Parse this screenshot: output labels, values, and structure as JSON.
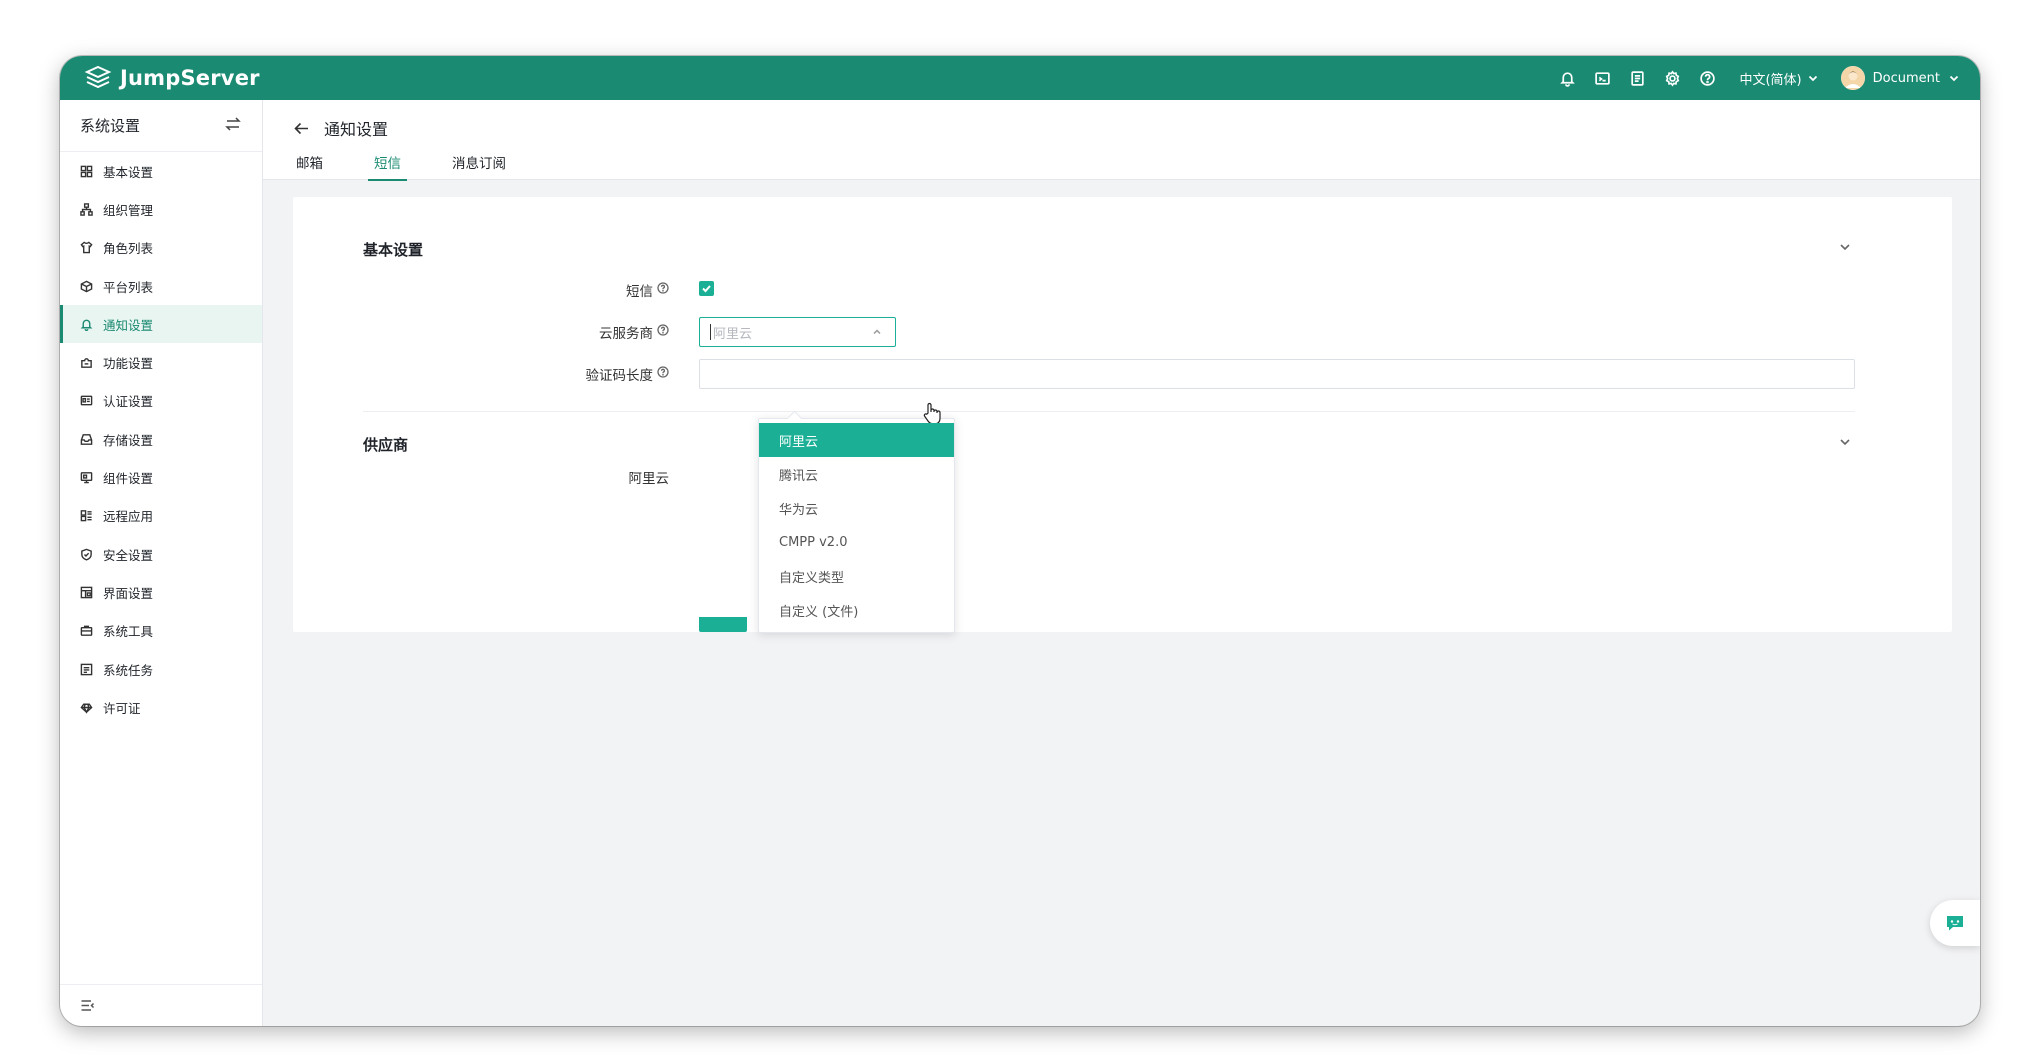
{
  "topbar": {
    "logo_text": "JumpServer",
    "icons": [
      "bell-icon",
      "terminal-icon",
      "document-icon",
      "gear-icon",
      "help-icon"
    ],
    "language": "中文(简体)",
    "username": "Document"
  },
  "sidebar": {
    "title": "系统设置",
    "items": [
      {
        "label": "基本设置",
        "icon": "grid-icon"
      },
      {
        "label": "组织管理",
        "icon": "org-tree-icon"
      },
      {
        "label": "角色列表",
        "icon": "shirt-icon"
      },
      {
        "label": "平台列表",
        "icon": "cube-icon"
      },
      {
        "label": "通知设置",
        "icon": "bell-icon",
        "active": true
      },
      {
        "label": "功能设置",
        "icon": "puzzle-icon"
      },
      {
        "label": "认证设置",
        "icon": "id-card-icon"
      },
      {
        "label": "存储设置",
        "icon": "storage-icon"
      },
      {
        "label": "组件设置",
        "icon": "component-icon"
      },
      {
        "label": "远程应用",
        "icon": "apps-icon"
      },
      {
        "label": "安全设置",
        "icon": "shield-icon"
      },
      {
        "label": "界面设置",
        "icon": "layout-icon"
      },
      {
        "label": "系统工具",
        "icon": "toolbox-icon"
      },
      {
        "label": "系统任务",
        "icon": "task-icon"
      },
      {
        "label": "许可证",
        "icon": "license-icon"
      }
    ]
  },
  "page": {
    "title": "通知设置",
    "tabs": [
      {
        "label": "邮箱"
      },
      {
        "label": "短信",
        "active": true
      },
      {
        "label": "消息订阅"
      }
    ]
  },
  "form": {
    "basic_section_title": "基本设置",
    "sms_label": "短信",
    "sms_enabled": true,
    "provider_label": "云服务商",
    "provider_placeholder": "阿里云",
    "code_length_label": "验证码长度",
    "supplier_section_title": "供应商",
    "aliyun_label": "阿里云"
  },
  "dropdown": {
    "options": [
      "阿里云",
      "腾讯云",
      "华为云",
      "CMPP v2.0",
      "自定义类型",
      "自定义 (文件)"
    ],
    "selected_index": 0
  },
  "colors": {
    "brand": "#1b8a72",
    "accent": "#1bb095"
  }
}
